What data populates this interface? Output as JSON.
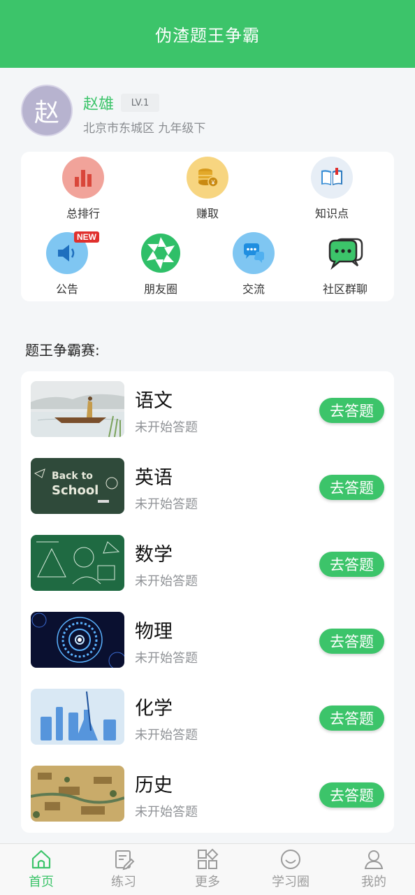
{
  "app": {
    "title": "伪渣题王争霸"
  },
  "profile": {
    "avatar_char": "赵",
    "name": "赵雄",
    "level": "LV.1",
    "region": "北京市东城区  九年级下"
  },
  "shortcuts": [
    {
      "label": "总排行",
      "icon": "bar-chart-icon"
    },
    {
      "label": "赚取",
      "icon": "coin-stack-icon"
    },
    {
      "label": "知识点",
      "icon": "book-icon"
    },
    {
      "label": "公告",
      "icon": "megaphone-icon",
      "badge": "NEW"
    },
    {
      "label": "朋友圈",
      "icon": "aperture-icon"
    },
    {
      "label": "交流",
      "icon": "chat-bubbles-icon"
    },
    {
      "label": "社区群聊",
      "icon": "group-chat-icon"
    }
  ],
  "section": {
    "title": "题王争霸赛:"
  },
  "subjects": [
    {
      "name": "语文",
      "status": "未开始答题",
      "action": "去答题"
    },
    {
      "name": "英语",
      "status": "未开始答题",
      "action": "去答题"
    },
    {
      "name": "数学",
      "status": "未开始答题",
      "action": "去答题"
    },
    {
      "name": "物理",
      "status": "未开始答题",
      "action": "去答题"
    },
    {
      "name": "化学",
      "status": "未开始答题",
      "action": "去答题"
    },
    {
      "name": "历史",
      "status": "未开始答题",
      "action": "去答题"
    }
  ],
  "thumb_text": {
    "english_line1": "Back to",
    "english_line2": "School"
  },
  "tabs": [
    {
      "label": "首页",
      "icon": "home-icon",
      "active": true
    },
    {
      "label": "练习",
      "icon": "edit-note-icon",
      "active": false
    },
    {
      "label": "更多",
      "icon": "grid-icon",
      "active": false
    },
    {
      "label": "学习圈",
      "icon": "smile-circle-icon",
      "active": false
    },
    {
      "label": "我的",
      "icon": "user-icon",
      "active": false
    }
  ],
  "colors": {
    "brand": "#3cc46a",
    "badge": "#e0302d"
  }
}
